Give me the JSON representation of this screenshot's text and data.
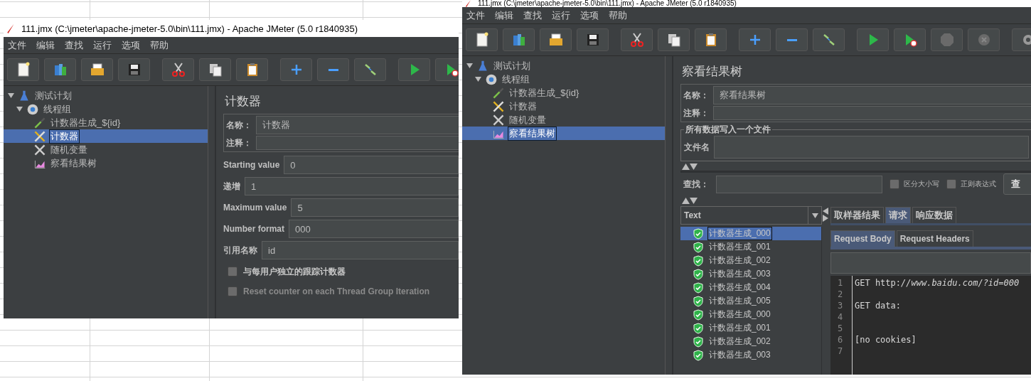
{
  "windows": [
    {
      "kind": "counter",
      "title": "111.jmx (C:\\jmeter\\apache-jmeter-5.0\\bin\\111.jmx) - Apache JMeter (5.0 r1840935)",
      "menu": [
        "文件",
        "编辑",
        "查找",
        "运行",
        "选项",
        "帮助"
      ],
      "toolbar_groups": [
        [
          {
            "kind": "new"
          },
          {
            "kind": "templates"
          },
          {
            "kind": "open"
          },
          {
            "kind": "save"
          }
        ],
        [
          {
            "kind": "cut"
          },
          {
            "kind": "copy"
          },
          {
            "kind": "paste"
          }
        ],
        [
          {
            "kind": "expand"
          },
          {
            "kind": "collapse"
          },
          {
            "kind": "toggle"
          }
        ],
        [
          {
            "kind": "start"
          },
          {
            "kind": "start-no-pause"
          }
        ]
      ],
      "tree": [
        {
          "label": "测试计划",
          "kind": "plan",
          "selected": false,
          "expanded": true,
          "children": [
            {
              "label": "线程组",
              "kind": "threads",
              "selected": false,
              "expanded": true,
              "children": [
                {
                  "label": "计数器生成_${id}",
                  "kind": "sampler",
                  "selected": false,
                  "expanded": false
                },
                {
                  "label": "计数器",
                  "kind": "counter",
                  "selected": true,
                  "expanded": false
                },
                {
                  "label": "随机变量",
                  "kind": "variable",
                  "selected": false,
                  "expanded": false
                },
                {
                  "label": "察看结果树",
                  "kind": "listener",
                  "selected": false,
                  "expanded": false
                }
              ]
            }
          ]
        }
      ],
      "panel": {
        "title": "计数器",
        "name_label": "名称：",
        "name_value": "计数器",
        "comment_label": "注释：",
        "fields": [
          {
            "label": "Starting value",
            "value": "0"
          },
          {
            "label": "递增",
            "value": "1"
          },
          {
            "label": "Maximum value",
            "value": "5"
          },
          {
            "label": "Number format",
            "value": "000"
          },
          {
            "label": "引用名称",
            "value": "id"
          }
        ],
        "options": [
          {
            "label": "与每用户独立的跟踪计数器",
            "checked": false,
            "disabled": false
          },
          {
            "label": "Reset counter on each Thread Group Iteration",
            "checked": false,
            "disabled": true
          }
        ]
      }
    },
    {
      "kind": "results_tree",
      "title": "111.jmx (C:\\jmeter\\apache-jmeter-5.0\\bin\\111.jmx) - Apache JMeter (5.0 r1840935)",
      "menu": [
        "文件",
        "编辑",
        "查找",
        "运行",
        "选项",
        "帮助"
      ],
      "toolbar_groups": [
        [
          {
            "kind": "new"
          },
          {
            "kind": "templates"
          },
          {
            "kind": "open"
          },
          {
            "kind": "save"
          }
        ],
        [
          {
            "kind": "cut"
          },
          {
            "kind": "copy"
          },
          {
            "kind": "paste"
          }
        ],
        [
          {
            "kind": "expand"
          },
          {
            "kind": "collapse"
          },
          {
            "kind": "toggle"
          }
        ],
        [
          {
            "kind": "start"
          },
          {
            "kind": "start-no-pause"
          },
          {
            "kind": "stop"
          },
          {
            "kind": "shutdown"
          }
        ],
        [
          {
            "kind": "clear"
          }
        ]
      ],
      "tree": [
        {
          "label": "测试计划",
          "kind": "plan",
          "selected": false,
          "expanded": true,
          "children": [
            {
              "label": "线程组",
              "kind": "threads",
              "selected": false,
              "expanded": true,
              "children": [
                {
                  "label": "计数器生成_${id}",
                  "kind": "sampler",
                  "selected": false,
                  "expanded": false
                },
                {
                  "label": "计数器",
                  "kind": "counter",
                  "selected": false,
                  "expanded": false
                },
                {
                  "label": "随机变量",
                  "kind": "variable",
                  "selected": false,
                  "expanded": false
                },
                {
                  "label": "察看结果树",
                  "kind": "listener",
                  "selected": true,
                  "expanded": false
                }
              ]
            }
          ]
        }
      ],
      "panel": {
        "title": "察看结果树",
        "name_label": "名称：",
        "name_value": "察看结果树",
        "comment_label": "注释：",
        "file_group": {
          "legend": "所有数据写入一个文件",
          "label": "文件名"
        },
        "search": {
          "label": "查找：",
          "options": [
            {
              "label": "区分大小写",
              "checked": false
            },
            {
              "label": "正则表达式",
              "checked": false
            }
          ],
          "button": "查"
        },
        "renderer": "Text",
        "samples": [
          {
            "label": "计数器生成_000",
            "selected": true
          },
          {
            "label": "计数器生成_001",
            "selected": false
          },
          {
            "label": "计数器生成_002",
            "selected": false
          },
          {
            "label": "计数器生成_003",
            "selected": false
          },
          {
            "label": "计数器生成_004",
            "selected": false
          },
          {
            "label": "计数器生成_005",
            "selected": false
          },
          {
            "label": "计数器生成_000",
            "selected": false
          },
          {
            "label": "计数器生成_001",
            "selected": false
          },
          {
            "label": "计数器生成_002",
            "selected": false
          },
          {
            "label": "计数器生成_003",
            "selected": false
          }
        ],
        "tabs": [
          {
            "label": "取样器结果",
            "selected": false
          },
          {
            "label": "请求",
            "selected": true
          },
          {
            "label": "响应数据",
            "selected": false
          }
        ],
        "subtabs": [
          {
            "label": "Request Body",
            "selected": true
          },
          {
            "label": "Request Headers",
            "selected": false
          }
        ],
        "code": [
          {
            "number": "1",
            "text": "GET http:*//www.baidu.com/?id=000*"
          },
          {
            "number": "2"
          },
          {
            "number": "3",
            "text": "GET data:"
          },
          {
            "number": "4"
          },
          {
            "number": "5"
          },
          {
            "number": "6",
            "text": "[no cookies]"
          },
          {
            "number": "7"
          }
        ]
      }
    }
  ]
}
